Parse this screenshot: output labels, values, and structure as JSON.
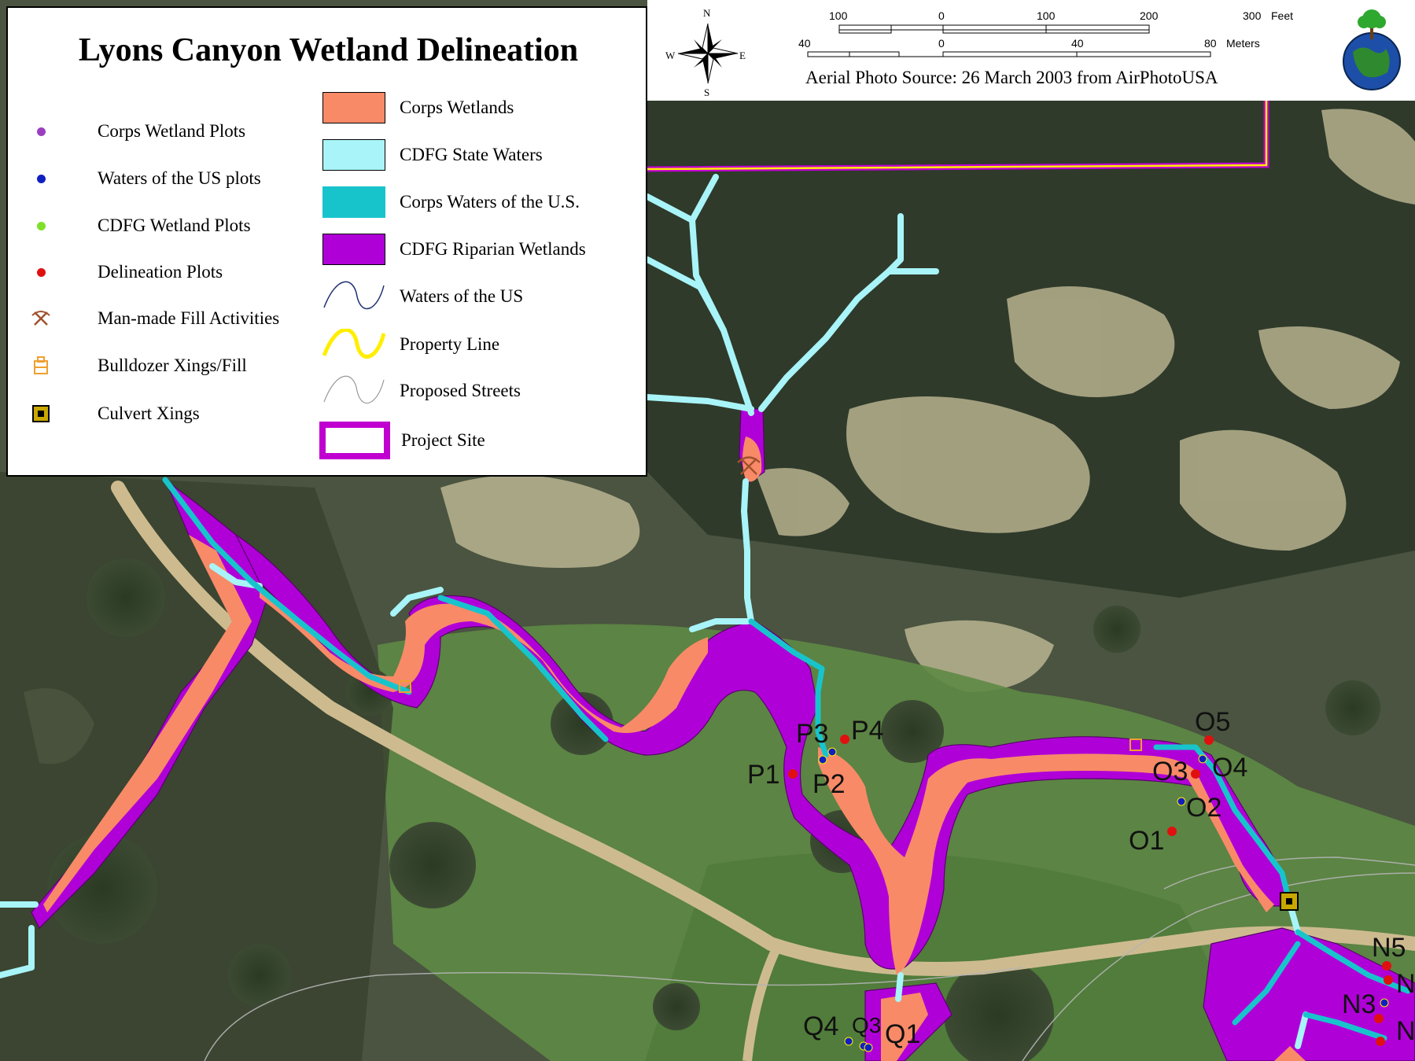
{
  "title": "Lyons Canyon Wetland Delineation",
  "legend": {
    "point_items": [
      {
        "label": "Corps Wetland Plots",
        "symbol": "purple-dot-icon",
        "color": "#9b3fc0"
      },
      {
        "label": "Waters of the US plots",
        "symbol": "blue-dot-icon",
        "color": "#1020c0"
      },
      {
        "label": "CDFG Wetland Plots",
        "symbol": "green-dot-icon",
        "color": "#7fe02a"
      },
      {
        "label": "Delineation Plots",
        "symbol": "red-dot-icon",
        "color": "#e01010"
      },
      {
        "label": "Man-made Fill Activities",
        "symbol": "pickaxe-icon",
        "color": "#a0522d"
      },
      {
        "label": "Bulldozer Xings/Fill",
        "symbol": "bulldozer-icon",
        "color": "#f0a030"
      },
      {
        "label": "Culvert Xings",
        "symbol": "culvert-icon",
        "color": "#c8a800"
      }
    ],
    "area_items": [
      {
        "label": "Corps Wetlands",
        "color": "#f88a68"
      },
      {
        "label": "CDFG State Waters",
        "color": "#a8f4f8"
      },
      {
        "label": "Corps Waters of the U.S.",
        "color": "#18c4cc"
      },
      {
        "label": "CDFG Riparian Wetlands",
        "color": "#b000d8"
      },
      {
        "label": "Waters of the US",
        "color": "#203070"
      },
      {
        "label": "Property Line",
        "color": "#ffee00"
      },
      {
        "label": "Proposed Streets",
        "color": "#9a9a9a"
      },
      {
        "label": "Project Site",
        "color": "#c000d0"
      }
    ]
  },
  "compass": {
    "n": "N",
    "s": "S",
    "e": "E",
    "w": "W"
  },
  "scale_bar": {
    "feet_ticks": [
      "100",
      "0",
      "100",
      "200",
      "300"
    ],
    "feet_unit": "Feet",
    "meters_ticks": [
      "40",
      "0",
      "40",
      "80"
    ],
    "meters_unit": "Meters"
  },
  "photo_source": "Aerial Photo Source:  26 March 2003 from AirPhotoUSA",
  "plot_labels": {
    "p3": "P3",
    "p4": "P4",
    "p1": "P1",
    "p2": "P2",
    "o5": "O5",
    "o3": "O3",
    "o4": "O4",
    "o2": "O2",
    "o1": "O1",
    "n5": "N5",
    "n_a": "N",
    "n3": "N3",
    "n_b": "N",
    "q4": "Q4",
    "q3": "Q3",
    "q1": "Q1"
  }
}
